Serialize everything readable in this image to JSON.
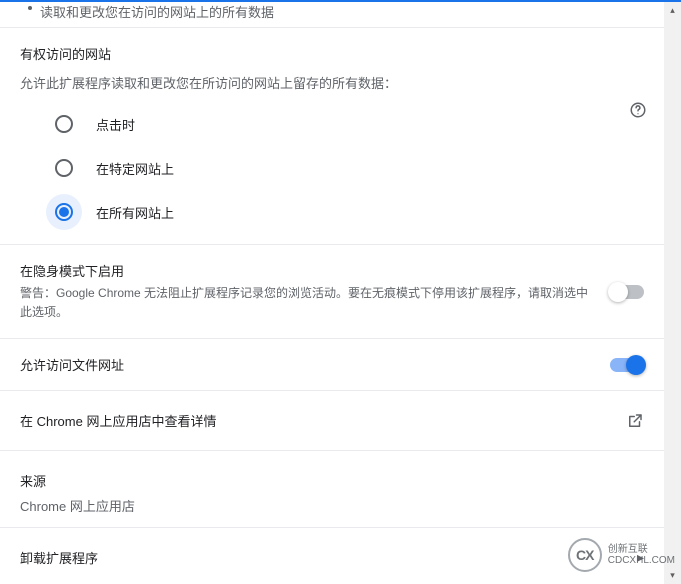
{
  "truncated_bullet": "读取和更改您在访问的网站上的所有数据",
  "site_access": {
    "title": "有权访问的网站",
    "subtitle": "允许此扩展程序读取和更改您在所访问的网站上留存的所有数据：",
    "options": {
      "on_click": "点击时",
      "on_specific": "在特定网站上",
      "on_all": "在所有网站上"
    },
    "help_tooltip": "帮助"
  },
  "incognito": {
    "title": "在隐身模式下启用",
    "desc": "警告：Google Chrome 无法阻止扩展程序记录您的浏览活动。要在无痕模式下停用该扩展程序，请取消选中此选项。"
  },
  "file_urls": {
    "title": "允许访问文件网址"
  },
  "store_link": "在 Chrome 网上应用店中查看详情",
  "source": {
    "label": "来源",
    "value": "Chrome 网上应用店"
  },
  "remove": "卸载扩展程序",
  "watermark": {
    "logo": "CX",
    "line1": "创新互联",
    "line2": "CDCXHL.COM"
  }
}
